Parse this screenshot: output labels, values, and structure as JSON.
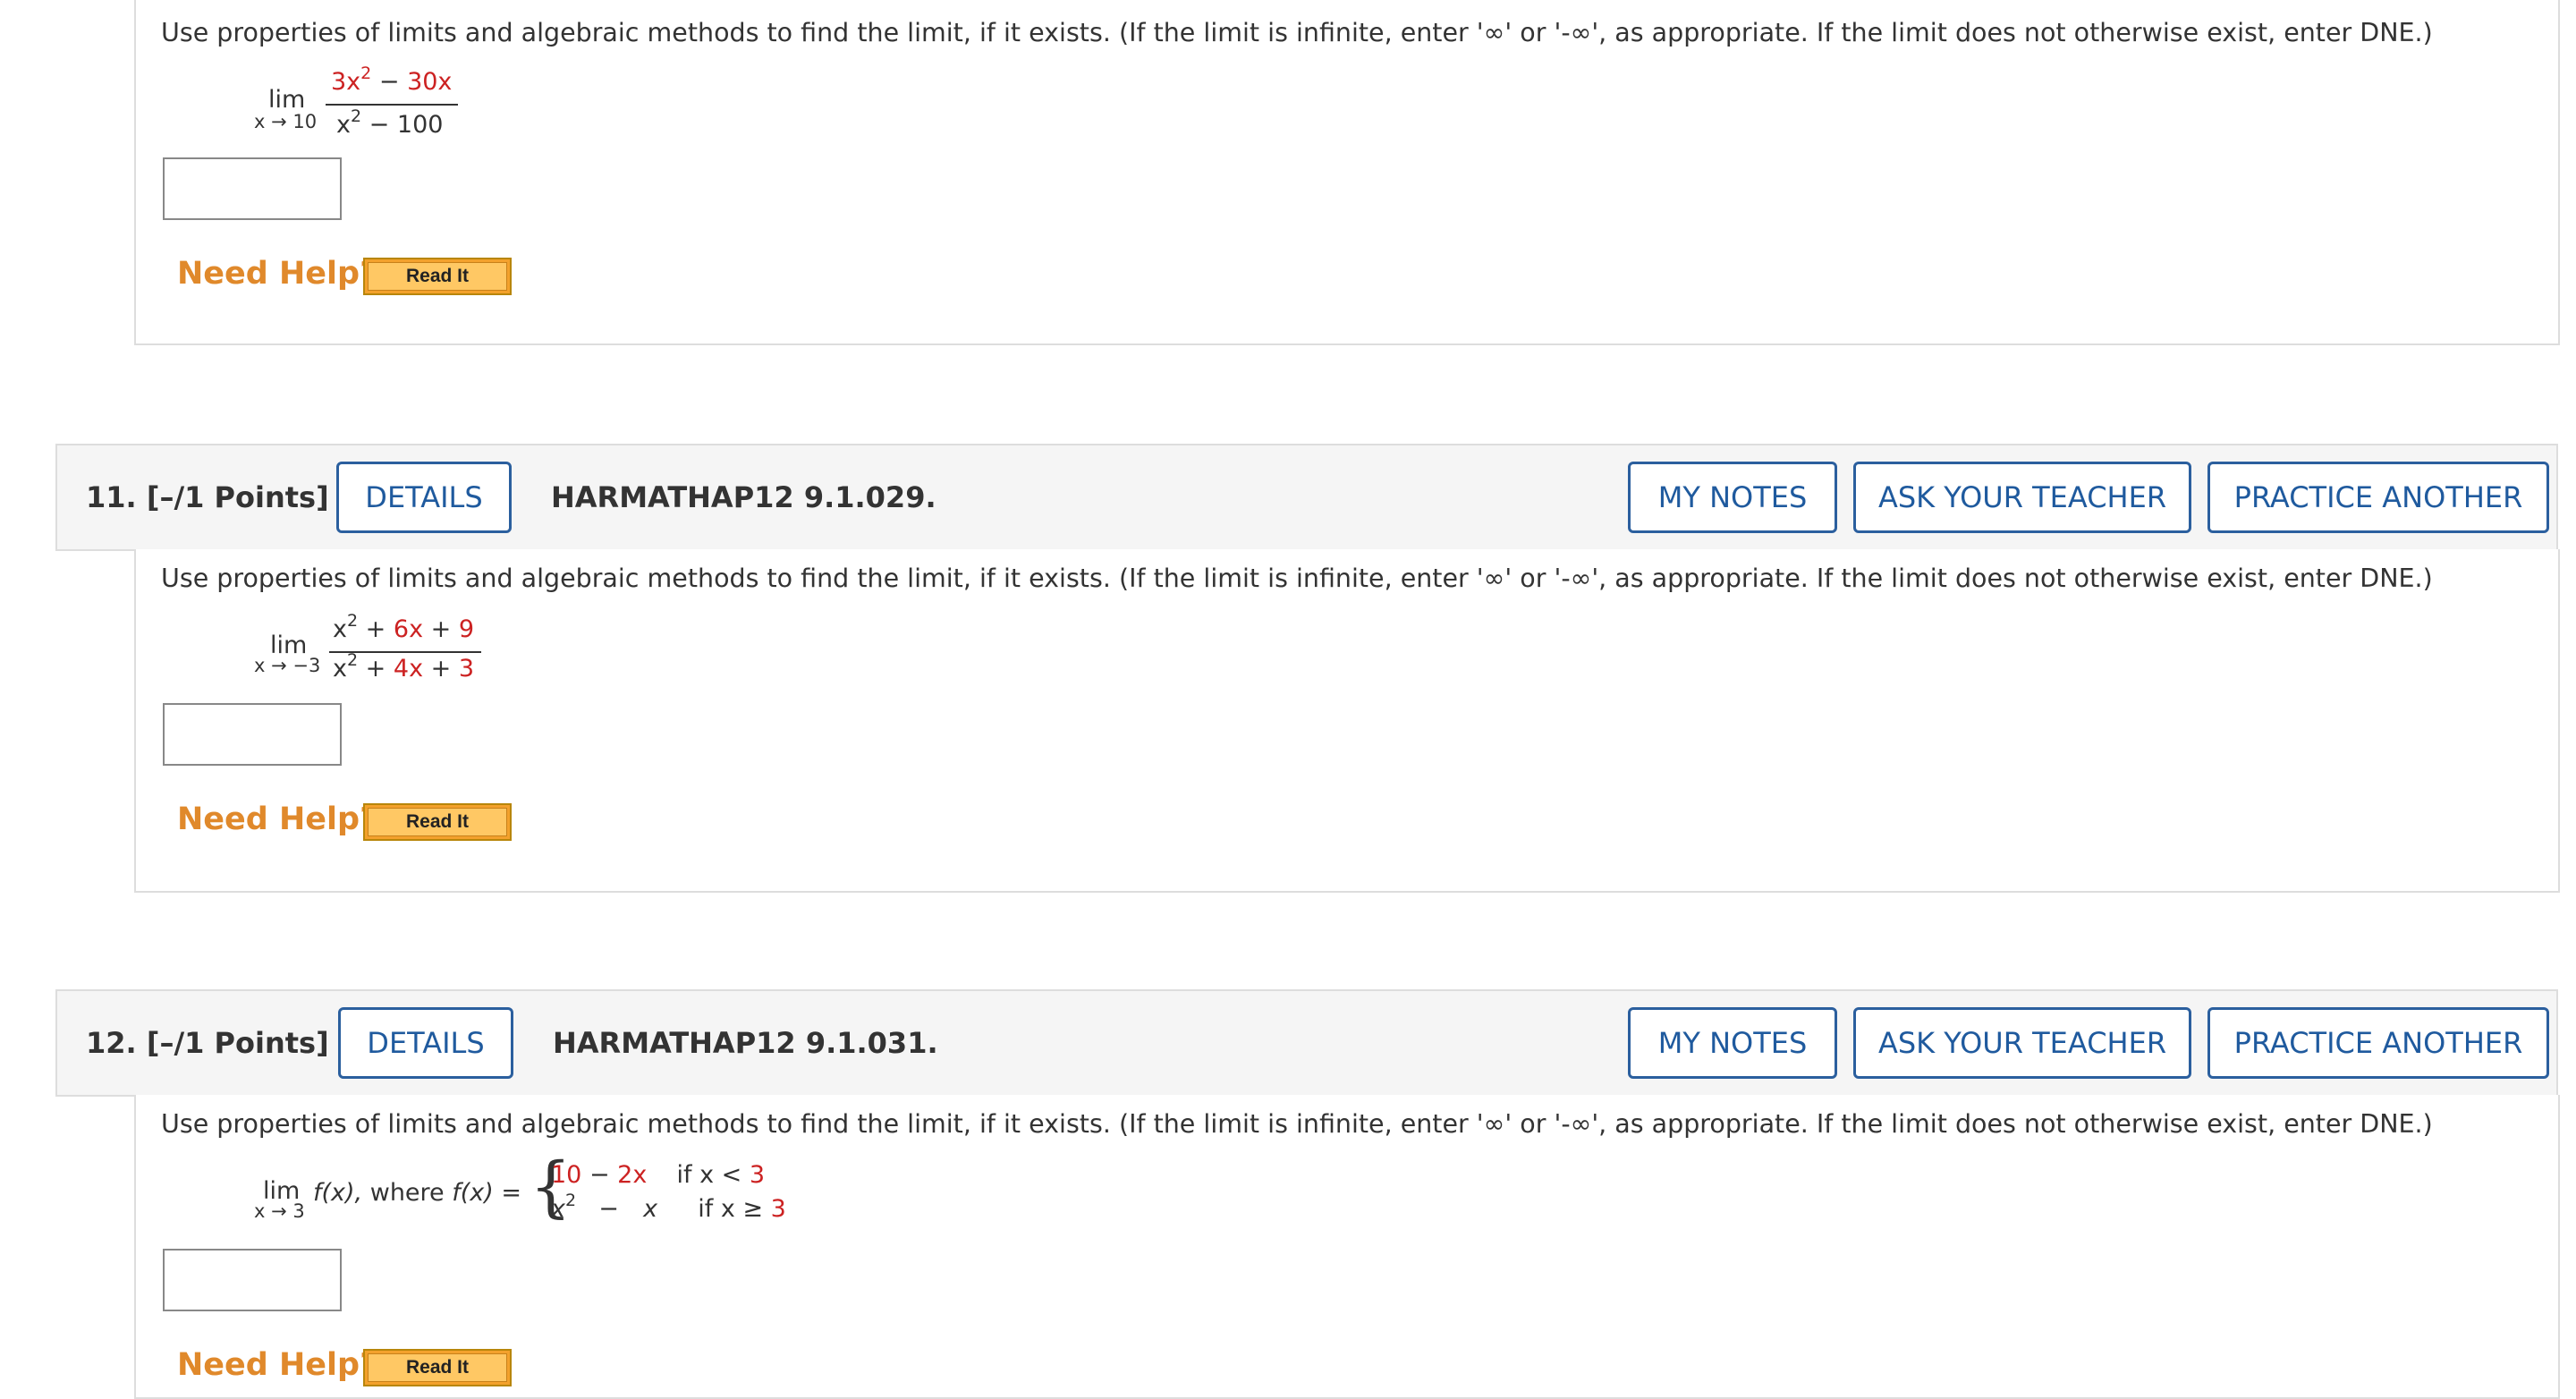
{
  "prompt_text": "Use properties of limits and algebraic methods to find the limit, if it exists. (If the limit is infinite, enter '∞' or '-∞', as appropriate. If the limit does not otherwise exist, enter DNE.)",
  "need_help": "Need Help?",
  "read_it": "Read It",
  "colors": {
    "accent_blue": "#1f5a9e",
    "help_orange": "#e0892b",
    "value_red": "#cc2222"
  },
  "q10": {
    "lim": "lim",
    "approach": "x → 10",
    "num_a": "3x",
    "num_exp": "2",
    "num_op": "−",
    "num_b": "30x",
    "den_a": "x",
    "den_exp": "2",
    "den_op": "−",
    "den_b": "100",
    "answer_value": ""
  },
  "q11": {
    "number": "11.",
    "points": "[–/1 Points]",
    "details": "DETAILS",
    "code": "HARMATHAP12 9.1.029.",
    "my_notes": "MY NOTES",
    "ask_teacher": "ASK YOUR TEACHER",
    "practice_another": "PRACTICE ANOTHER",
    "lim": "lim",
    "approach": "x → −3",
    "num_a": "x",
    "num_exp": "2",
    "num_op1": "+",
    "num_b": "6x",
    "num_op2": "+",
    "num_c": "9",
    "den_a": "x",
    "den_exp": "2",
    "den_op1": "+",
    "den_b": "4x",
    "den_op2": "+",
    "den_c": "3",
    "answer_value": ""
  },
  "q12": {
    "number": "12.",
    "points": "[–/1 Points]",
    "details": "DETAILS",
    "code": "HARMATHAP12 9.1.031.",
    "my_notes": "MY NOTES",
    "ask_teacher": "ASK YOUR TEACHER",
    "practice_another": "PRACTICE ANOTHER",
    "lim": "lim",
    "approach": "x → 3",
    "fx": "f(x),",
    "where": "where",
    "fx_def": "f(x) =",
    "case1_a": "10",
    "case1_op": "−",
    "case1_b": "2x",
    "case1_cond": "if x <",
    "case1_val": "3",
    "case2_a": "x",
    "case2_exp": "2",
    "case2_op": "−",
    "case2_b": "x",
    "case2_cond": "if x ≥",
    "case2_val": "3",
    "answer_value": ""
  }
}
